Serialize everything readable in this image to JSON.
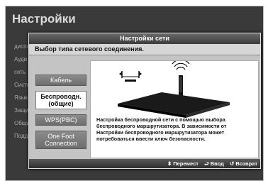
{
  "background": {
    "title": "Настройки",
    "menu": [
      "диспл",
      "Ауди",
      "сеть",
      "Систе",
      "Язык",
      "Защи",
      "Общи",
      "Подд"
    ]
  },
  "dialog": {
    "title": "Настройки сети",
    "subtitle": "Выбор типа сетевого соединения.",
    "options": [
      {
        "label": "Кабель",
        "selected": false
      },
      {
        "label": "Беспроводн. (общие)",
        "selected": true
      },
      {
        "label": "WPS(PBC)",
        "selected": false
      },
      {
        "label": "One Foot Connection",
        "selected": false
      }
    ],
    "description": "Настройка беспроводной сети с помощью выбора беспроводного маршрутизатора. В зависимости от Настройки беспроводного маршрутизатора может потребоваться ввести ключ безопасности.",
    "footer": {
      "move": "Перемест",
      "enter": "Ввод",
      "back": "Возврат"
    }
  },
  "icons": [
    "updown-arrow-icon",
    "enter-icon",
    "return-icon",
    "router-icon",
    "wireless-icon",
    "tv-stand-icon"
  ]
}
